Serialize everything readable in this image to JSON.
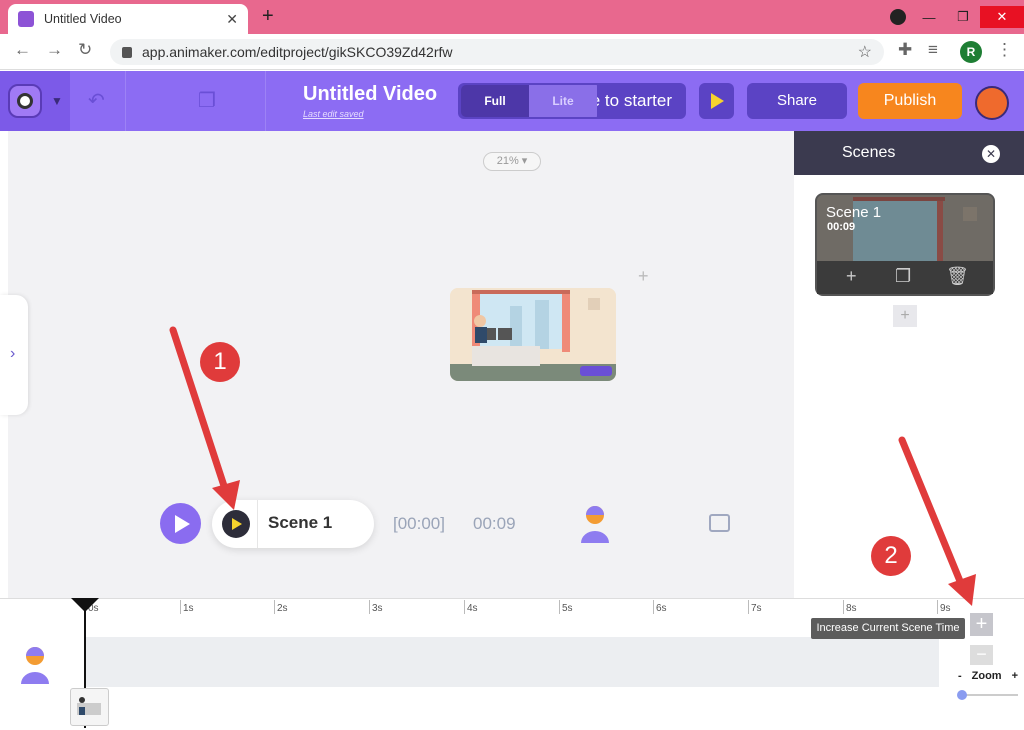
{
  "browser": {
    "tab_title": "Untitled Video",
    "tab_close": "✕",
    "new_tab": "+",
    "url": "app.animaker.com/editproject/gikSKCO39Zd42rfw",
    "profile_initial": "R"
  },
  "header": {
    "video_title": "Untitled Video",
    "last_saved": "Last edit saved",
    "mode_full": "Full",
    "mode_lite": "Lite",
    "starter_label": "e to starter",
    "share_label": "Share",
    "publish_label": "Publish"
  },
  "canvas": {
    "zoom_level": "21% ▾"
  },
  "playback": {
    "scene_label": "Scene 1",
    "start_time": "[00:00]",
    "duration": "00:09"
  },
  "scenes_panel": {
    "title": "Scenes",
    "close": "✕",
    "scene_card_title": "Scene 1",
    "scene_card_time": "00:09"
  },
  "timeline": {
    "ticks": [
      "0s",
      "1s",
      "2s",
      "3s",
      "4s",
      "5s",
      "6s",
      "7s",
      "8s",
      "9s"
    ],
    "tooltip": "Increase Current Scene Time",
    "zoom_label": "Zoom",
    "zoom_minus": "-",
    "zoom_plus": "+"
  },
  "annotations": {
    "badge_1": "1",
    "badge_2": "2"
  },
  "colors": {
    "header_purple": "#8c6cf3",
    "publish_orange": "#f7861e",
    "tab_pink": "#e8688e",
    "annotation_red": "#e03b3b"
  }
}
